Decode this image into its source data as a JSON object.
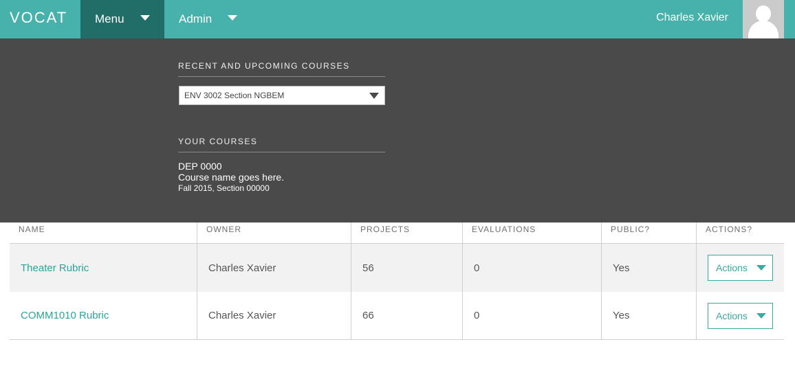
{
  "header": {
    "logo": "VOCAT",
    "nav": [
      {
        "label": "Menu",
        "active": true
      },
      {
        "label": "Admin",
        "active": false
      }
    ],
    "user_name": "Charles Xavier",
    "avatar_icon": "user-silhouette-icon"
  },
  "dropdown_panel": {
    "recent_heading": "RECENT AND UPCOMING COURSES",
    "course_select_value": "ENV 3002 Section NGBEM",
    "your_courses_heading": "YOUR COURSES",
    "your_courses": [
      {
        "code": "DEP 0000",
        "name": "Course name goes here.",
        "term": "Fall 2015, Section 00000"
      }
    ]
  },
  "table": {
    "columns": [
      "NAME",
      "OWNER",
      "PROJECTS",
      "EVALUATIONS",
      "PUBLIC?",
      "ACTIONS?"
    ],
    "rows": [
      {
        "name": "Theater Rubric",
        "owner": "Charles Xavier",
        "projects": "56",
        "evaluations": "0",
        "public": "Yes",
        "action_label": "Actions"
      },
      {
        "name": "COMM1010 Rubric",
        "owner": "Charles Xavier",
        "projects": "66",
        "evaluations": "0",
        "public": "Yes",
        "action_label": "Actions"
      }
    ]
  },
  "colors": {
    "topbar": "#47b2ab",
    "active_nav": "#216d68",
    "panel": "#4a4a4a",
    "link": "#2ba39a"
  }
}
